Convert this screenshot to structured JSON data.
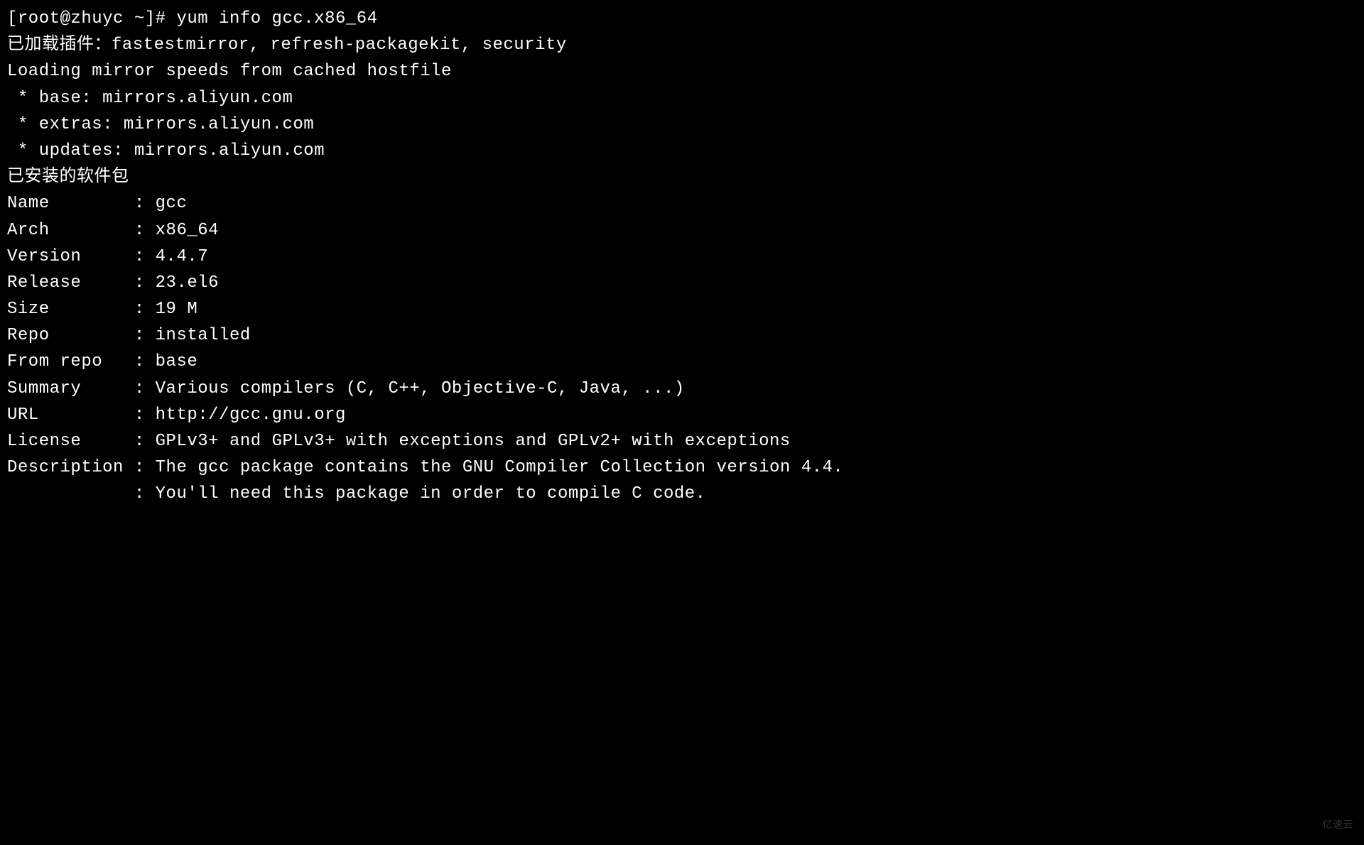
{
  "prompt": "[root@zhuyc ~]# ",
  "command": "yum info gcc.x86_64",
  "plugins_line": "已加载插件：fastestmirror, refresh-packagekit, security",
  "loading_line": "Loading mirror speeds from cached hostfile",
  "mirrors": [
    " * base: mirrors.aliyun.com",
    " * extras: mirrors.aliyun.com",
    " * updates: mirrors.aliyun.com"
  ],
  "installed_header": "已安装的软件包",
  "fields": [
    {
      "label": "Name       ",
      "sep": " : ",
      "value": "gcc"
    },
    {
      "label": "Arch       ",
      "sep": " : ",
      "value": "x86_64"
    },
    {
      "label": "Version    ",
      "sep": " : ",
      "value": "4.4.7"
    },
    {
      "label": "Release    ",
      "sep": " : ",
      "value": "23.el6"
    },
    {
      "label": "Size       ",
      "sep": " : ",
      "value": "19 M"
    },
    {
      "label": "Repo       ",
      "sep": " : ",
      "value": "installed"
    },
    {
      "label": "From repo  ",
      "sep": " : ",
      "value": "base"
    },
    {
      "label": "Summary    ",
      "sep": " : ",
      "value": "Various compilers (C, C++, Objective-C, Java, ...)"
    },
    {
      "label": "URL        ",
      "sep": " : ",
      "value": "http://gcc.gnu.org"
    },
    {
      "label": "License    ",
      "sep": " : ",
      "value": "GPLv3+ and GPLv3+ with exceptions and GPLv2+ with exceptions"
    },
    {
      "label": "Description",
      "sep": " : ",
      "value": "The gcc package contains the GNU Compiler Collection version 4.4."
    },
    {
      "label": "           ",
      "sep": " : ",
      "value": "You'll need this package in order to compile C code."
    }
  ],
  "watermark": "亿速云"
}
